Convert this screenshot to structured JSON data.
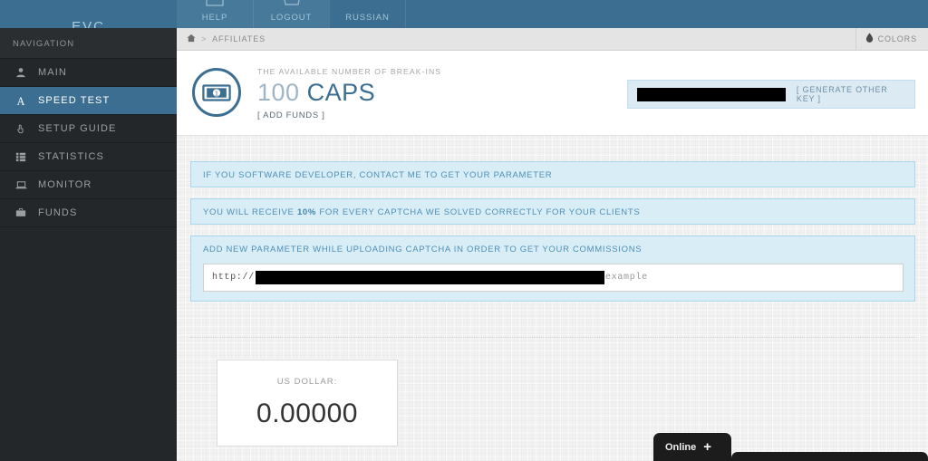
{
  "brand": {
    "name": "EVC"
  },
  "topnav": {
    "items": [
      {
        "label": "HELP",
        "icon": "help-icon"
      },
      {
        "label": "LOGOUT",
        "icon": "logout-icon"
      },
      {
        "label": "RUSSIAN",
        "icon": "flag-icon"
      }
    ]
  },
  "sidebar": {
    "heading": "NAVIGATION",
    "items": [
      {
        "label": "MAIN",
        "icon": "user-icon",
        "active": false
      },
      {
        "label": "SPEED TEST",
        "icon": "font-a-icon",
        "active": true
      },
      {
        "label": "SETUP GUIDE",
        "icon": "hand-pointer-icon",
        "active": false
      },
      {
        "label": "STATISTICS",
        "icon": "list-grid-icon",
        "active": false
      },
      {
        "label": "MONITOR",
        "icon": "laptop-icon",
        "active": false
      },
      {
        "label": "FUNDS",
        "icon": "briefcase-icon",
        "active": false
      }
    ]
  },
  "breadcrumb": {
    "home_icon": "home-icon",
    "separator": ">",
    "current": "AFFILIATES"
  },
  "colors_button": {
    "label": "COLORS",
    "icon": "droplet-icon"
  },
  "header_panel": {
    "icon": "banknote-circle-icon",
    "subtitle": "THE AVAILABLE NUMBER OF BREAK-INS",
    "amount_number": "100",
    "amount_unit": " CAPS",
    "add_funds_label": "[ ADD FUNDS ]",
    "key_value": "",
    "generate_key_label": "[ GENERATE OTHER KEY ]"
  },
  "alerts": [
    {
      "text": "IF YOU SOFTWARE DEVELOPER, CONTACT ME TO GET YOUR PARAMETER"
    },
    {
      "text_before": "YOU WILL RECEIVE ",
      "bold": "10%",
      "text_after": " FOR EVERY CAPTCHA WE SOLVED CORRECTLY FOR YOUR CLIENTS"
    },
    {
      "text": "ADD NEW PARAMETER WHILE UPLOADING CAPTCHA IN ORDER TO GET YOUR COMMISSIONS"
    }
  ],
  "url_field": {
    "prefix": "http://",
    "redacted_value": "",
    "suffix": "example"
  },
  "usd_card": {
    "label": "US DOLLAR:",
    "value": "0.00000"
  },
  "chat": {
    "status_label": "Online",
    "toggle_icon": "plus-icon"
  },
  "colors": {
    "brand_blue": "#3c6e91",
    "sidebar_dark": "#232729",
    "alert_bg": "#d9edf7",
    "alert_border": "#a9d6ea",
    "alert_text": "#4d8fb5",
    "page_bg": "#f2f2f2"
  }
}
